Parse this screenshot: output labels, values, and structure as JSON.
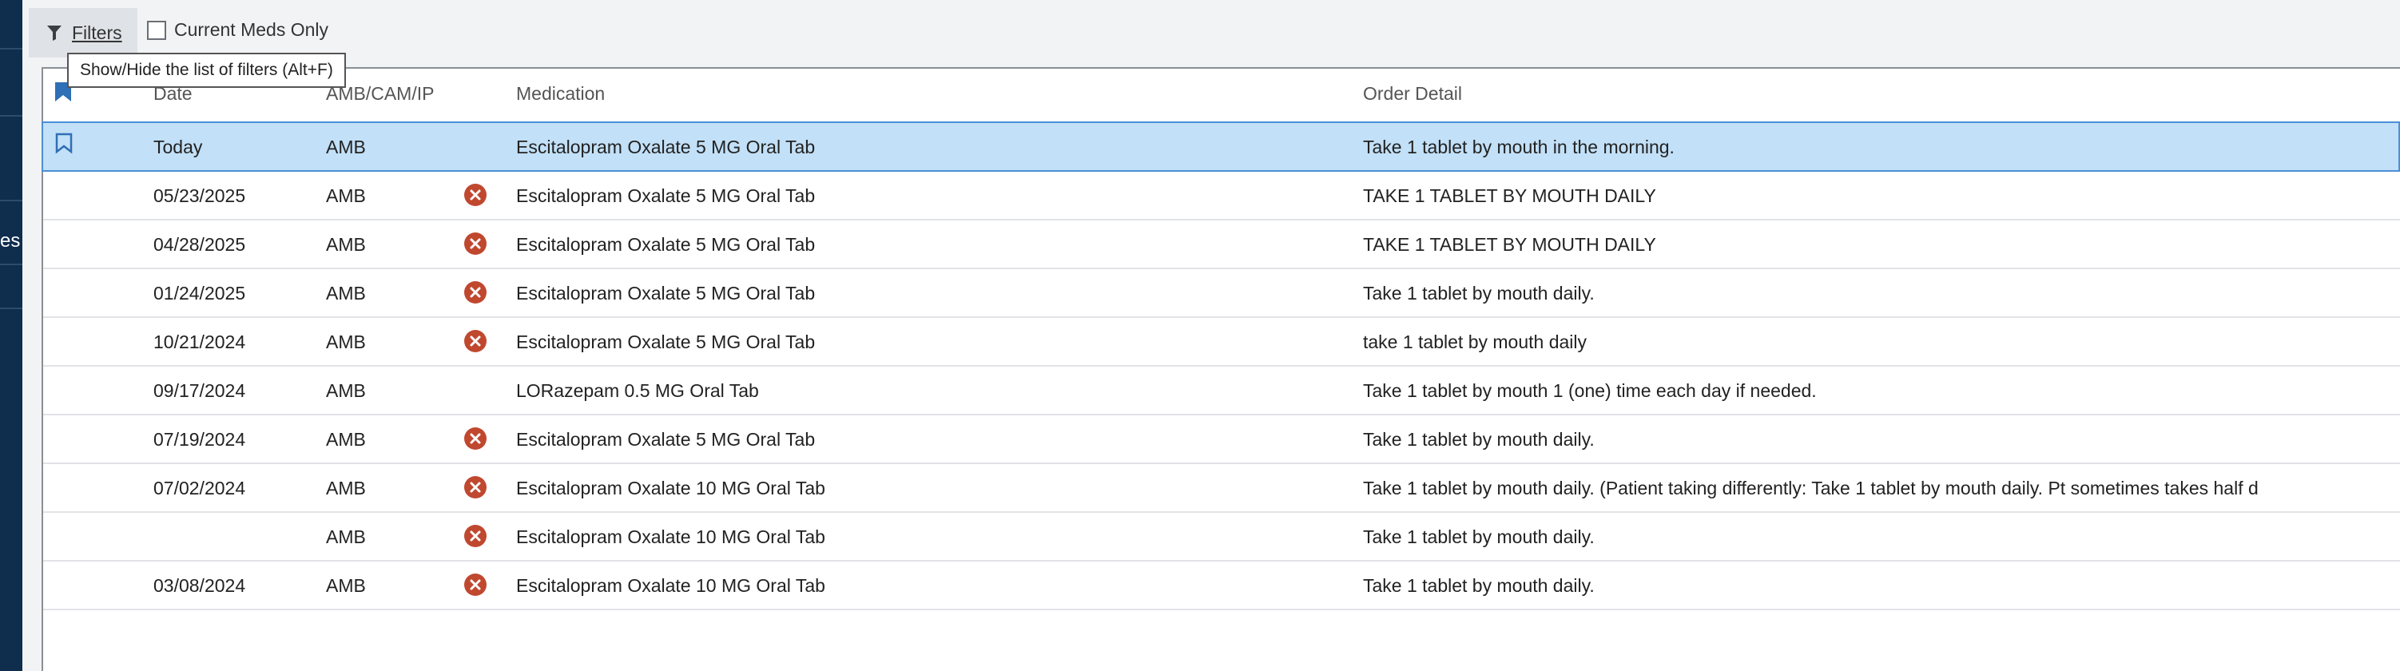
{
  "left_nav": {
    "fragment_text": "es"
  },
  "toolbar": {
    "filters_label": "Filters",
    "current_meds_label": "Current Meds Only",
    "current_meds_checked": false
  },
  "tooltip": {
    "text": "Show/Hide the list of filters (Alt+F)"
  },
  "table": {
    "columns": [
      "Date",
      "AMB/CAM/IP",
      "Medication",
      "Order Detail"
    ],
    "rows": [
      {
        "date": "Today",
        "source": "AMB",
        "discontinued": false,
        "medication": "Escitalopram Oxalate 5 MG Oral Tab",
        "detail": "Take 1 tablet by mouth in the morning.",
        "selected": true
      },
      {
        "date": "05/23/2025",
        "source": "AMB",
        "discontinued": true,
        "medication": "Escitalopram Oxalate 5 MG Oral Tab",
        "detail": "TAKE 1 TABLET BY MOUTH DAILY"
      },
      {
        "date": "04/28/2025",
        "source": "AMB",
        "discontinued": true,
        "medication": "Escitalopram Oxalate 5 MG Oral Tab",
        "detail": "TAKE 1 TABLET BY MOUTH DAILY"
      },
      {
        "date": "01/24/2025",
        "source": "AMB",
        "discontinued": true,
        "medication": "Escitalopram Oxalate 5 MG Oral Tab",
        "detail": "Take 1 tablet by mouth daily."
      },
      {
        "date": "10/21/2024",
        "source": "AMB",
        "discontinued": true,
        "medication": "Escitalopram Oxalate 5 MG Oral Tab",
        "detail": "take 1 tablet by mouth daily"
      },
      {
        "date": "09/17/2024",
        "source": "AMB",
        "discontinued": false,
        "medication": "LORazepam 0.5 MG Oral Tab",
        "detail": "Take 1 tablet by mouth 1 (one) time each day if needed."
      },
      {
        "date": "07/19/2024",
        "source": "AMB",
        "discontinued": true,
        "medication": "Escitalopram Oxalate 5 MG Oral Tab",
        "detail": "Take 1 tablet by mouth daily."
      },
      {
        "date": "07/02/2024",
        "source": "AMB",
        "discontinued": true,
        "medication": "Escitalopram Oxalate 10 MG Oral Tab",
        "detail": "Take 1 tablet by mouth daily. (Patient taking differently: Take 1 tablet by mouth daily. Pt sometimes takes half d"
      },
      {
        "date": "",
        "source": "AMB",
        "discontinued": true,
        "medication": "Escitalopram Oxalate 10 MG Oral Tab",
        "detail": "Take 1 tablet by mouth daily."
      },
      {
        "date": "03/08/2024",
        "source": "AMB",
        "discontinued": true,
        "medication": "Escitalopram Oxalate 10 MG Oral Tab",
        "detail": "Take 1 tablet by mouth daily."
      }
    ]
  },
  "colors": {
    "nav_bg": "#0f2d4d",
    "selected_row_bg": "#c2e0f7",
    "selected_row_border": "#4a90d6",
    "discontinued_icon": "#c0482f",
    "bookmark": "#2e6fb5"
  },
  "icons": {
    "filters": "funnel-icon",
    "discontinued": "x-circle-icon",
    "bookmark": "bookmark-icon"
  }
}
